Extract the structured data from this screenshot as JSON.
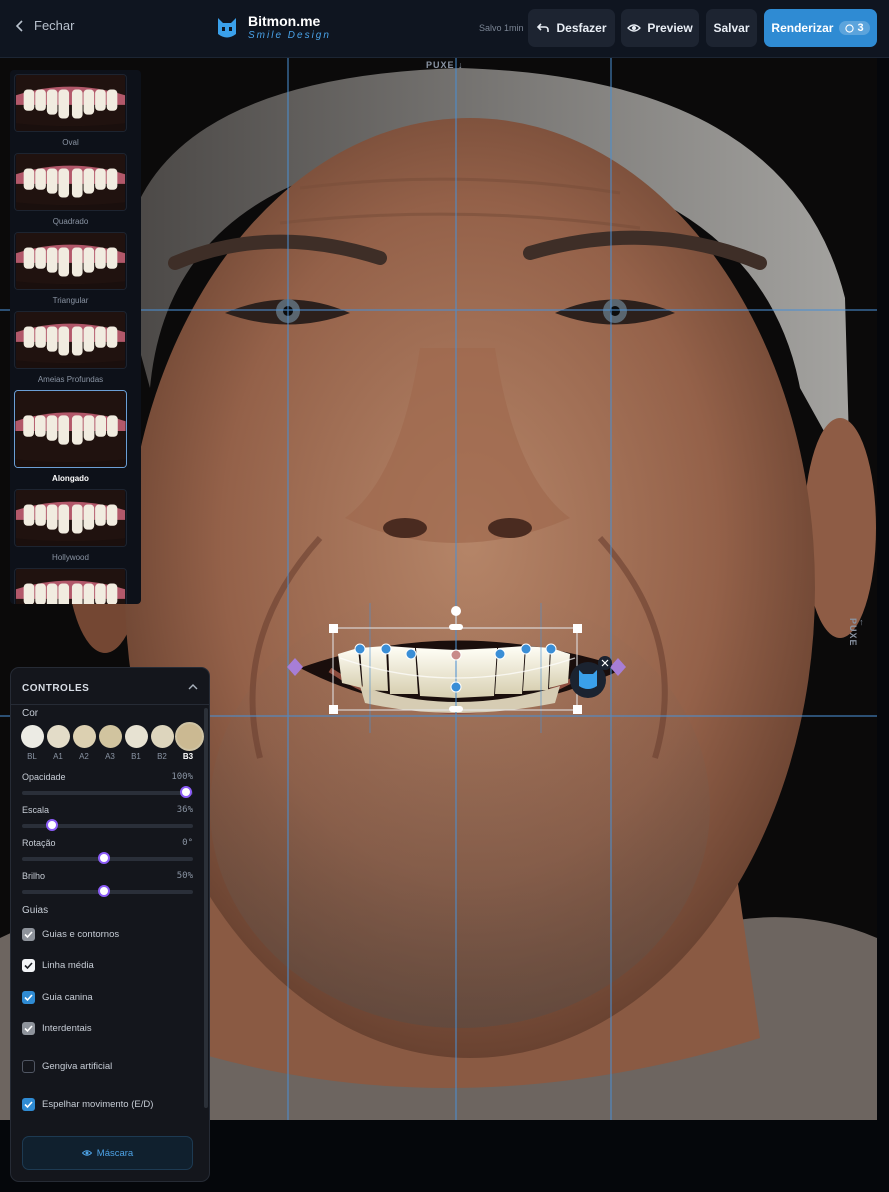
{
  "header": {
    "close_label": "Fechar",
    "brand_name": "Bitmon.me",
    "brand_tag": "Smile Design",
    "saved_status": "Salvo 1min",
    "undo_label": "Desfazer",
    "preview_label": "Preview",
    "save_label": "Salvar",
    "render_label": "Renderizar",
    "render_credits": "3",
    "accent_color": "#2f8bd3"
  },
  "canvas": {
    "puxe_top": "PUXE ↓",
    "puxe_right": "← PUXE"
  },
  "library": {
    "shapes": [
      {
        "label": "Oval",
        "active": false
      },
      {
        "label": "Quadrado",
        "active": false
      },
      {
        "label": "Triangular",
        "active": false
      },
      {
        "label": "Ameias Profundas",
        "active": false
      },
      {
        "label": "Alongado",
        "active": true
      },
      {
        "label": "Hollywood",
        "active": false
      },
      {
        "label": "",
        "active": false
      }
    ]
  },
  "controls": {
    "title": "CONTROLES",
    "color_label": "Cor",
    "shades": [
      {
        "code": "BL",
        "hex": "#ecebe4"
      },
      {
        "code": "A1",
        "hex": "#e3dcc8"
      },
      {
        "code": "A2",
        "hex": "#dcd0b1"
      },
      {
        "code": "A3",
        "hex": "#d1c49f"
      },
      {
        "code": "B1",
        "hex": "#e7e2d2"
      },
      {
        "code": "B2",
        "hex": "#ddd5bd"
      },
      {
        "code": "B3",
        "hex": "#cbb992"
      }
    ],
    "selected_shade": "B3",
    "sliders": [
      {
        "label": "Opacidade",
        "value": "100%",
        "level": 1.0
      },
      {
        "label": "Escala",
        "value": "36%",
        "level": 0.18
      },
      {
        "label": "Rotação",
        "value": "0°",
        "level": 0.5
      },
      {
        "label": "Brilho",
        "value": "50%",
        "level": 0.5
      }
    ],
    "guides_label": "Guias",
    "checks": [
      {
        "label": "Guias e contornos",
        "checked": true,
        "style": "gray"
      },
      {
        "label": "Linha média",
        "checked": true,
        "style": "white"
      },
      {
        "label": "Guia canina",
        "checked": true,
        "style": "blue"
      },
      {
        "label": "Interdentais",
        "checked": true,
        "style": "gray"
      },
      {
        "label": "Gengiva artificial",
        "checked": false,
        "style": "empty"
      },
      {
        "label": "Espelhar movimento (E/D)",
        "checked": true,
        "style": "blue"
      }
    ],
    "mask_label": "Máscara"
  }
}
